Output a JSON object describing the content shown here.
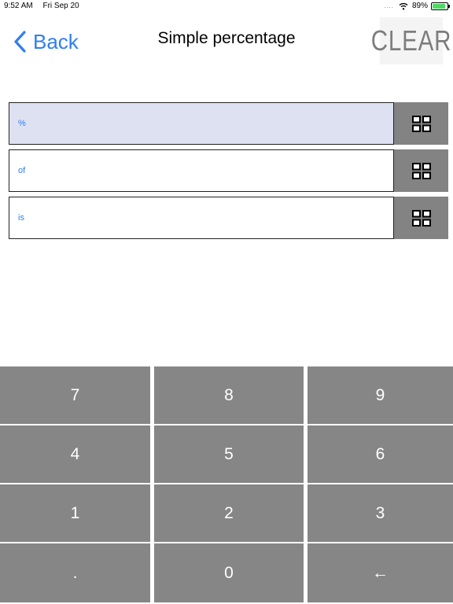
{
  "status_bar": {
    "time": "9:52 AM",
    "date": "Fri Sep 20",
    "signal": "....",
    "battery_percent": "89%",
    "battery_level": 0.89,
    "charging": true
  },
  "nav": {
    "back_label": "Back",
    "title": "Simple percentage",
    "clear_label": "CLEAR"
  },
  "inputs": [
    {
      "label": "%",
      "active": true
    },
    {
      "label": "of",
      "active": false
    },
    {
      "label": "is",
      "active": false
    }
  ],
  "keypad": {
    "rows": [
      [
        "7",
        "8",
        "9"
      ],
      [
        "4",
        "5",
        "6"
      ],
      [
        "1",
        "2",
        "3"
      ],
      [
        ".",
        "0",
        "←"
      ]
    ]
  },
  "colors": {
    "accent": "#2f7ef2",
    "key_background": "#868686",
    "grid_button_background": "#838383",
    "active_field_background": "#dde1f1"
  }
}
